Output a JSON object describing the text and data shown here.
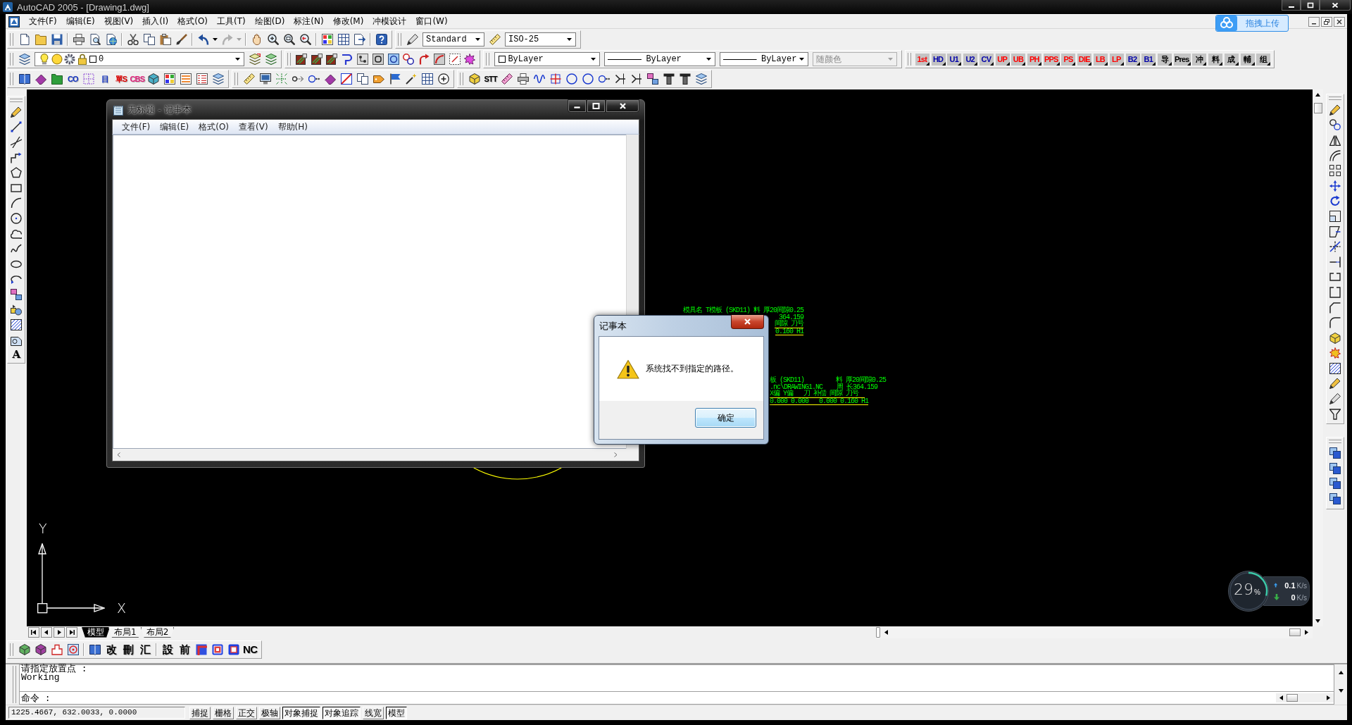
{
  "window": {
    "title": "AutoCAD 2005 - [Drawing1.dwg]"
  },
  "menu_bar": {
    "items": [
      "文件(F)",
      "编辑(E)",
      "视图(V)",
      "插入(I)",
      "格式(O)",
      "工具(T)",
      "绘图(D)",
      "标注(N)",
      "修改(M)",
      "冲模设计",
      "窗口(W)"
    ]
  },
  "upload_widget": {
    "label": "拖拽上传"
  },
  "standard_toolbar": {
    "redo": {
      "disabled": true
    }
  },
  "styles_toolbar": {
    "text_style": "Standard",
    "dimension_style": "ISO-25"
  },
  "layers_toolbar": {
    "current_layer": "0"
  },
  "properties_toolbar": {
    "current_color": "ByLayer",
    "linetype": "ByLayer",
    "lineweight": "ByLayer",
    "plot_style": {
      "value": "随颜色",
      "disabled": true
    }
  },
  "text_toolbar_1": {
    "buttons": [
      {
        "label": "1st",
        "color": "#ff0000"
      },
      {
        "label": "HD",
        "color": "#0000a8"
      },
      {
        "label": "U1",
        "color": "#0000a8"
      },
      {
        "label": "U2",
        "color": "#0000a8"
      },
      {
        "label": "CV",
        "color": "#0000a8"
      },
      {
        "label": "UP",
        "color": "#ff0000"
      },
      {
        "label": "UB",
        "color": "#ff0000"
      },
      {
        "label": "PH",
        "color": "#ff0000"
      },
      {
        "label": "PPS",
        "color": "#ff0000"
      },
      {
        "label": "PS",
        "color": "#ff0000"
      },
      {
        "label": "DIE",
        "color": "#ff0000"
      },
      {
        "label": "LB",
        "color": "#ff0000"
      },
      {
        "label": "LP",
        "color": "#ff0000"
      },
      {
        "label": "B2",
        "color": "#0000a8"
      },
      {
        "label": "B1",
        "color": "#0000a8"
      },
      {
        "label": "导",
        "color": "#000000"
      },
      {
        "label": "Pres",
        "color": "#000000"
      },
      {
        "label": "冲",
        "color": "#000000"
      },
      {
        "label": "料",
        "color": "#000000"
      },
      {
        "label": "成",
        "color": "#000000"
      },
      {
        "label": "輔",
        "color": "#000000"
      },
      {
        "label": "组",
        "color": "#000000"
      }
    ]
  },
  "text_toolbar_2": {
    "buttons": [
      {
        "label": "CO",
        "color": "#1030c0"
      },
      {
        "label": "目",
        "color": "#1030c0"
      },
      {
        "label": "單S",
        "color": "#e00000"
      },
      {
        "label": "CBS",
        "color": "#e0207a"
      },
      {
        "label": "STT",
        "color": "#000000"
      }
    ]
  },
  "draw_toolbar": {
    "buttons": [
      {
        "label": "A"
      }
    ]
  },
  "drawing": {
    "axes": {
      "x_label": "X",
      "y_label": "Y"
    },
    "annotations": [
      {
        "title": "模具名 T模板 (SKD11) 料 厚20间隙0.25",
        "detail": "364.159",
        "header": "间隙 刀号",
        "values": "0.160 H1"
      },
      {
        "title": "板 (SKD11)         料 厚20间隙0.25",
        "detail": ".nc\\DRAWING1.NC    周 长364.159",
        "header": "X偏 Y偏   刀 补偿 间隙 刀号",
        "values": "0.000 0.000   0.000 0.160 H1"
      }
    ]
  },
  "notepad": {
    "title": "无标题 - 记事本",
    "menu": [
      "文件(F)",
      "编辑(E)",
      "格式(O)",
      "查看(V)",
      "帮助(H)"
    ]
  },
  "message_box": {
    "title": "记事本",
    "message": "系统找不到指定的路径。",
    "button": "确定"
  },
  "speed_widget": {
    "gauge": {
      "value": "29",
      "unit": "%"
    },
    "upload": {
      "value": "0.1",
      "unit": "K/s"
    },
    "download": {
      "value": "0",
      "unit": "K/s"
    }
  },
  "layout_tabs": [
    {
      "label": "模型",
      "selected": true
    },
    {
      "label": "布局1",
      "selected": false
    },
    {
      "label": "布局2",
      "selected": false
    }
  ],
  "bottom_toolbar": {
    "buttons": [
      {
        "label": "改"
      },
      {
        "label": "刪"
      },
      {
        "label": "汇"
      },
      {
        "label": "設"
      },
      {
        "label": "前"
      },
      {
        "label": "NC"
      }
    ]
  },
  "command_window": {
    "history": [
      "请指定放置点 :",
      "Working"
    ],
    "prompt": "命令 :"
  },
  "status_bar": {
    "coordinates": "1225.4667, 632.0033, 0.0000",
    "toggles": [
      {
        "label": "捕捉",
        "on": false
      },
      {
        "label": "栅格",
        "on": false
      },
      {
        "label": "正交",
        "on": false
      },
      {
        "label": "极轴",
        "on": false
      },
      {
        "label": "对象捕捉",
        "on": true
      },
      {
        "label": "对象追踪",
        "on": true
      },
      {
        "label": "线宽",
        "on": false
      },
      {
        "label": "模型",
        "on": true
      }
    ]
  }
}
